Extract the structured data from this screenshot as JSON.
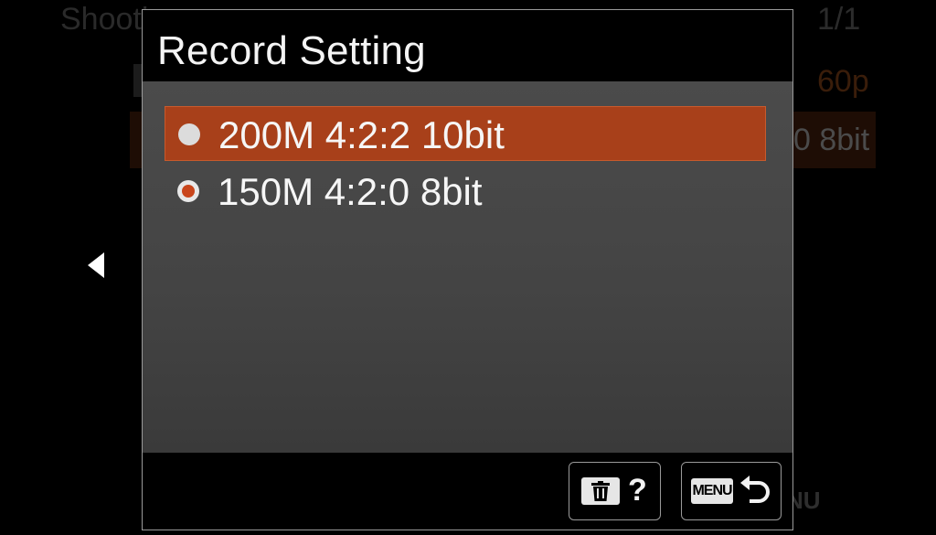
{
  "background": {
    "header_label": "Shooti",
    "page_indicator": "1/1",
    "row1_value": "60p",
    "row2_value": "0 8bit",
    "menu_icon_text": "NU"
  },
  "dialog": {
    "title": "Record Setting",
    "options": [
      {
        "label": "200M 4:2:2 10bit",
        "highlighted": true,
        "checked": false
      },
      {
        "label": "150M 4:2:0 8bit",
        "highlighted": false,
        "checked": true
      }
    ],
    "footer": {
      "help_label": "?",
      "menu_label": "MENU"
    }
  },
  "colors": {
    "highlight": "#a8401a",
    "radio_dot": "#c9461c",
    "panel": "#4b4b4b"
  },
  "icons": {
    "left_nav": "left-arrow-icon",
    "delete": "trash-icon",
    "back": "return-arrow-icon"
  }
}
